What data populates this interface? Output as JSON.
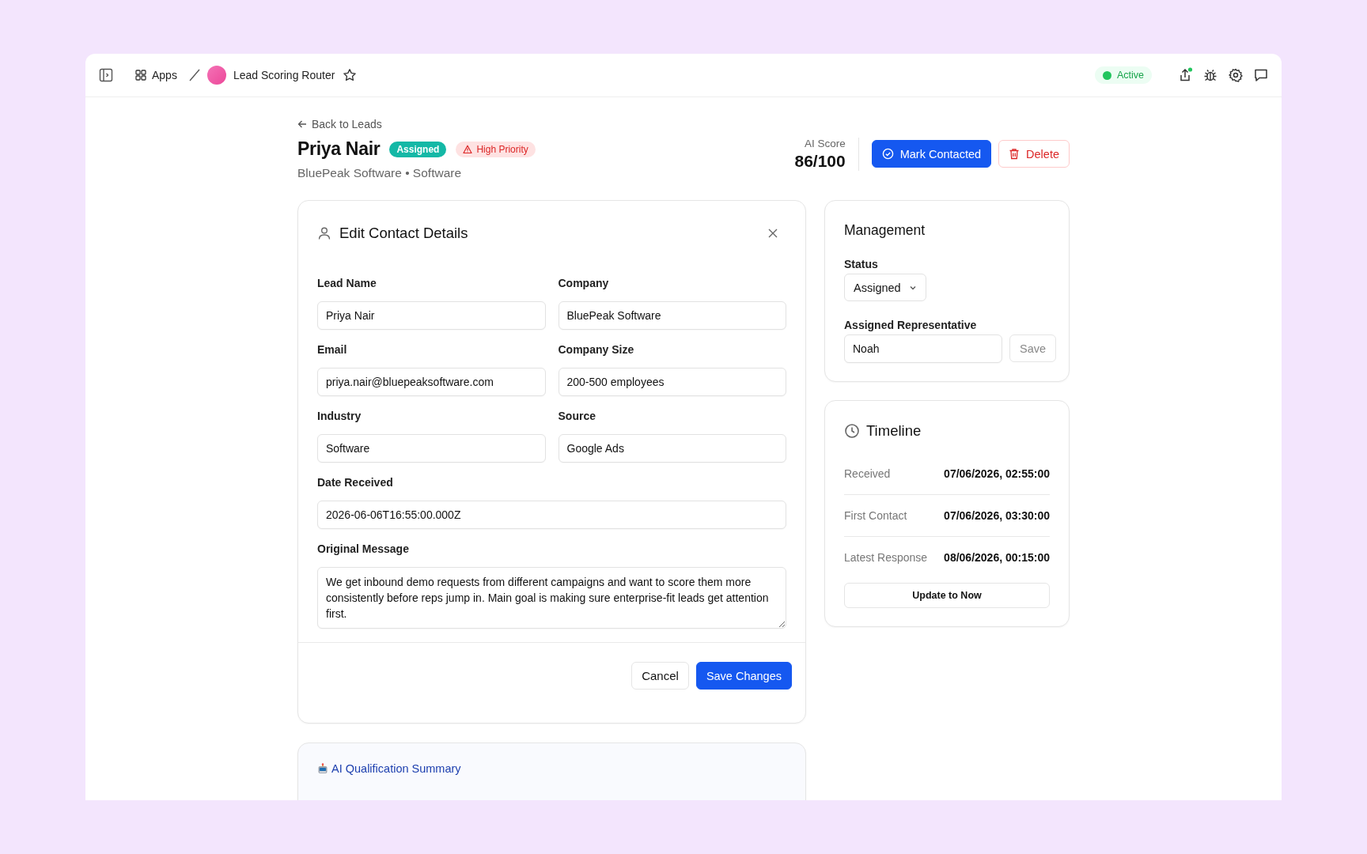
{
  "topbar": {
    "apps_label": "Apps",
    "app_name": "Lead Scoring Router",
    "favorite": false,
    "status": "Active"
  },
  "header": {
    "back_link": "Back to Leads",
    "name": "Priya Nair",
    "badges": [
      {
        "label": "Assigned",
        "kind": "status"
      },
      {
        "label": "High Priority",
        "kind": "priority"
      }
    ],
    "subtitle": "BluePeak Software • Software",
    "score_label": "AI Score",
    "score": "86/100",
    "buttons": [
      {
        "label": "Mark Contacted",
        "kind": "primary"
      },
      {
        "label": "Delete",
        "kind": "danger"
      }
    ]
  },
  "edit_card": {
    "title": "Edit Contact Details",
    "rows": [
      [
        {
          "label": "Lead Name",
          "value": "Priya Nair",
          "kind": "input"
        },
        {
          "label": "Company",
          "value": "BluePeak Software",
          "kind": "input"
        }
      ],
      [
        {
          "label": "Email",
          "value": "priya.nair@bluepeaksoftware.com",
          "kind": "input"
        },
        {
          "label": "Company Size",
          "value": "200-500 employees",
          "kind": "input"
        }
      ],
      [
        {
          "label": "Industry",
          "value": "Software",
          "kind": "input"
        },
        {
          "label": "Source",
          "value": "Google Ads",
          "kind": "input"
        }
      ],
      [
        {
          "label": "Date Received",
          "value": "2026-06-06T16:55:00.000Z",
          "kind": "input"
        }
      ],
      [
        {
          "label": "Original Message",
          "value": "We get inbound demo requests from different campaigns and want to score them more consistently before reps jump in. Main goal is making sure enterprise-fit leads get attention first.",
          "kind": "textarea"
        }
      ]
    ],
    "buttons": [
      {
        "label": "Cancel",
        "kind": "secondary"
      },
      {
        "label": "Save Changes",
        "kind": "primary"
      }
    ]
  },
  "summary_card": {
    "title": "AI Qualification Summary"
  },
  "management": {
    "title": "Management",
    "status_label": "Status",
    "status_value": "Assigned",
    "rep_label": "Assigned Representative",
    "rep_value": "Noah",
    "save_label": "Save"
  },
  "timeline": {
    "title": "Timeline",
    "rows": [
      {
        "label": "Received",
        "value": "07/06/2026, 02:55:00"
      },
      {
        "label": "First Contact",
        "value": "07/06/2026, 03:30:00"
      },
      {
        "label": "Latest Response",
        "value": "08/06/2026, 00:15:00"
      }
    ],
    "button": "Update to Now"
  }
}
